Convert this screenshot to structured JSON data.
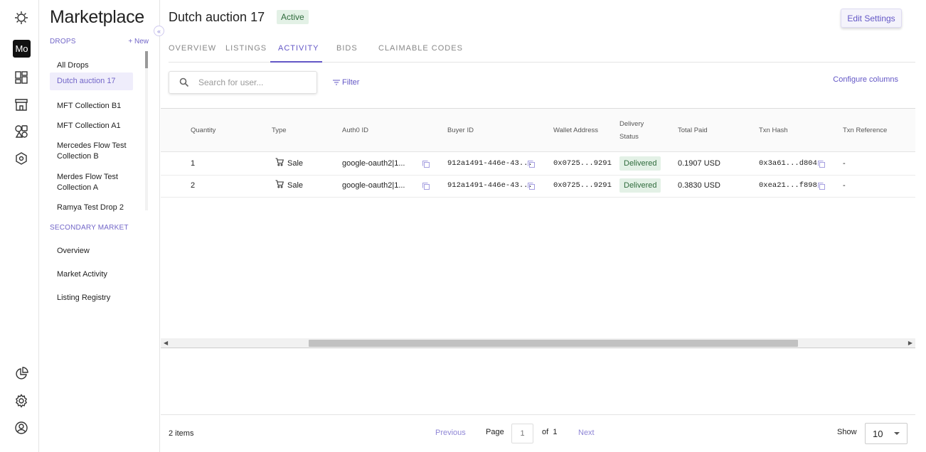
{
  "rail": {
    "avatar_text": "Mo"
  },
  "sidebar": {
    "title": "Marketplace",
    "drops_section": "DROPS",
    "new_label": "+ New",
    "drops": [
      {
        "label": "All Drops"
      },
      {
        "label": "Dutch auction 17"
      },
      {
        "label": "MFT Collection B1"
      },
      {
        "label": "MFT Collection A1"
      },
      {
        "label": "Mercedes Flow Test Collection B"
      },
      {
        "label": "Merdes Flow Test Collection A"
      },
      {
        "label": "Ramya Test Drop 2"
      }
    ],
    "secondary_section": "SECONDARY MARKET",
    "secondary": [
      {
        "label": "Overview"
      },
      {
        "label": "Market Activity"
      },
      {
        "label": "Listing Registry"
      }
    ]
  },
  "header": {
    "title": "Dutch auction 17",
    "status": "Active",
    "edit_label": "Edit Settings"
  },
  "tabs": [
    {
      "label": "OVERVIEW"
    },
    {
      "label": "LISTINGS"
    },
    {
      "label": "ACTIVITY"
    },
    {
      "label": "BIDS"
    },
    {
      "label": "CLAIMABLE CODES"
    }
  ],
  "toolbar": {
    "search_placeholder": "Search for user...",
    "filter_label": "Filter",
    "configure_label": "Configure columns"
  },
  "table": {
    "columns": [
      "Quantity",
      "Type",
      "Auth0 ID",
      "Buyer ID",
      "Wallet Address",
      "Delivery Status",
      "Total Paid",
      "Txn Hash",
      "Txn Reference"
    ],
    "delivery_header_1": "Delivery",
    "delivery_header_2": "Status",
    "rows": [
      {
        "quantity": "1",
        "type": "Sale",
        "auth0": "google-oauth2|1...",
        "buyer": "912a1491-446e-43...",
        "wallet": "0x0725...9291",
        "status": "Delivered",
        "total": "0.1907 USD",
        "hash": "0x3a61...d804",
        "ref": "-"
      },
      {
        "quantity": "2",
        "type": "Sale",
        "auth0": "google-oauth2|1...",
        "buyer": "912a1491-446e-43...",
        "wallet": "0x0725...9291",
        "status": "Delivered",
        "total": "0.3830 USD",
        "hash": "0xea21...f898",
        "ref": "-"
      }
    ]
  },
  "footer": {
    "items_count": "2 items",
    "previous": "Previous",
    "page_label": "Page",
    "page_value": "1",
    "of_label": "of",
    "total_pages": "1",
    "next": "Next",
    "show_label": "Show",
    "page_size": "10"
  },
  "colors": {
    "accent": "#6357c6",
    "success_bg": "#e3f1e6",
    "success_text": "#2f6b3c"
  }
}
